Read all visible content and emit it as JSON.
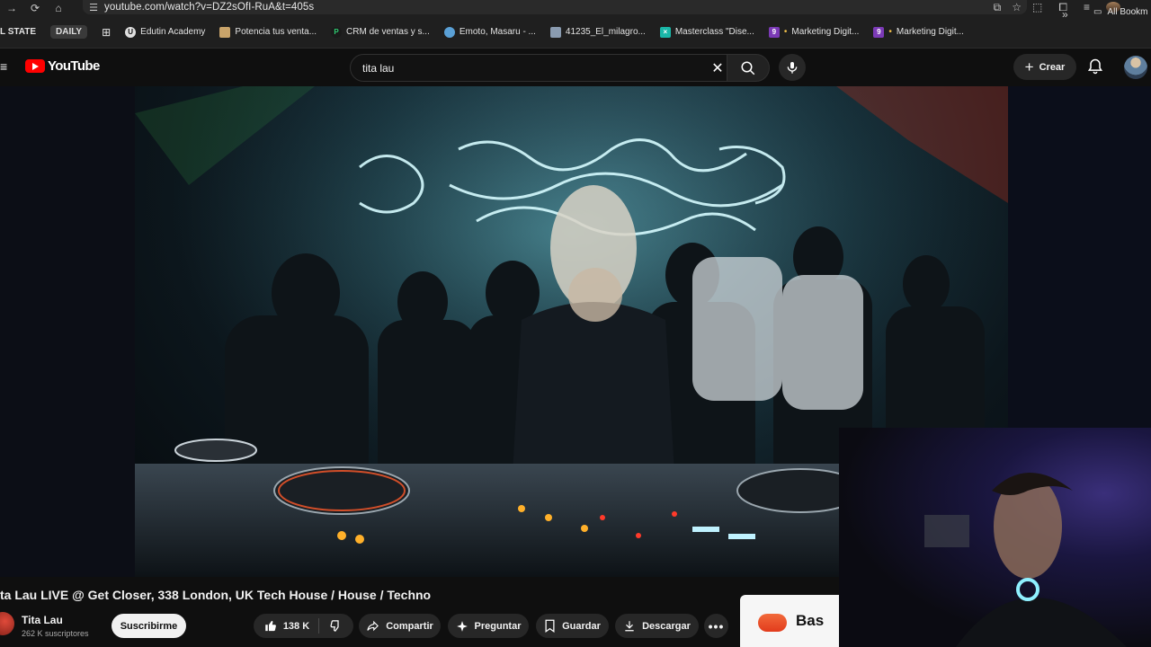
{
  "browser": {
    "url": "youtube.com/watch?v=DZ2sOfI-RuA&t=405s",
    "bookmarks": [
      {
        "label": "L STATE",
        "icon": "none"
      },
      {
        "label": "DAILY",
        "icon": "none"
      },
      {
        "label": "",
        "icon": "apps-grid-icon"
      },
      {
        "label": "Edutin Academy",
        "icon": "edutin-icon"
      },
      {
        "label": "Potencia tus venta...",
        "icon": "bookmark-favicon"
      },
      {
        "label": "CRM de ventas y s...",
        "icon": "pipedrive-icon"
      },
      {
        "label": "Emoto, Masaru - ...",
        "icon": "globe-icon"
      },
      {
        "label": "41235_El_milagro...",
        "icon": "document-icon"
      },
      {
        "label": "Masterclass \"Dise...",
        "icon": "masterclass-icon"
      },
      {
        "label": "Marketing Digit...",
        "icon": "q-favicon"
      },
      {
        "label": "Marketing Digit...",
        "icon": "q-favicon"
      }
    ],
    "all_bookmarks": "All Bookm"
  },
  "youtube": {
    "logo_text": "YouTube",
    "search_value": "tita lau",
    "create_label": "Crear"
  },
  "video": {
    "title": "ta Lau LIVE @ Get Closer, 338 London, UK Tech House / House / Techno",
    "channel_name": "Tita Lau",
    "subscribers": "262 K suscriptores",
    "subscribe_label": "Suscribirme",
    "likes": "138 K",
    "share_label": "Compartir",
    "ask_label": "Preguntar",
    "save_label": "Guardar",
    "download_label": "Descargar",
    "ad_text": "Bas"
  },
  "colors": {
    "yt_red": "#ff0000",
    "bg": "#0f0f0f",
    "pill": "#272727"
  }
}
